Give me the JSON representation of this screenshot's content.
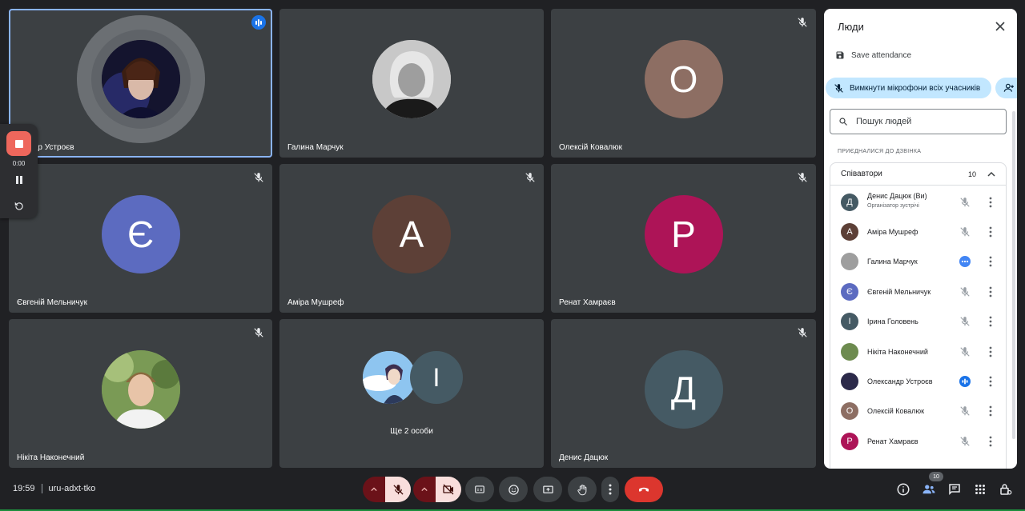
{
  "meeting": {
    "time": "19:59",
    "code": "uru-adxt-tko"
  },
  "recording": {
    "timer": "0:00"
  },
  "tiles": [
    {
      "name": "ксандр Устроєв",
      "speaking": true
    },
    {
      "name": "Галина Марчук"
    },
    {
      "name": "Олексій Ковалюк",
      "initial": "О",
      "color": "#8d6e63"
    },
    {
      "name": "Євгеній Мельничук",
      "initial": "Є",
      "color": "#5c6bc0"
    },
    {
      "name": "Аміра Мушреф",
      "initial": "А",
      "color": "#5d4037"
    },
    {
      "name": "Ренат Хамраєв",
      "initial": "Р",
      "color": "#ad1457"
    },
    {
      "name": "Нікіта Наконечний"
    },
    {
      "more_label": "Ще 2 особи",
      "initial": "І",
      "color": "#455a64"
    },
    {
      "name": "Денис Дацюк",
      "initial": "Д",
      "color": "#455a64"
    }
  ],
  "panel": {
    "title": "Люди",
    "save_attendance": "Save attendance",
    "mute_all": "Вимкнути мікрофони всіх учасників",
    "search_placeholder": "Пошук людей",
    "joined_label": "Приєдналися до дзвінка",
    "group_name": "Співавтори",
    "group_count": "10",
    "people": [
      {
        "name": "Денис Дацюк (Ви)",
        "sub": "Організатор зустрічі",
        "initial": "Д",
        "color": "#455a64",
        "status": "muted"
      },
      {
        "name": "Аміра Мушреф",
        "initial": "А",
        "color": "#5d4037",
        "status": "muted"
      },
      {
        "name": "Галина Марчук",
        "initial": "",
        "color": "#9e9e9e",
        "status": "dots"
      },
      {
        "name": "Євгеній Мельничук",
        "initial": "Є",
        "color": "#5c6bc0",
        "status": "muted"
      },
      {
        "name": "Ірина Головень",
        "initial": "І",
        "color": "#455a64",
        "status": "muted"
      },
      {
        "name": "Нікіта Наконечний",
        "initial": "",
        "color": "#6d8b4f",
        "status": "muted"
      },
      {
        "name": "Олександр Устроєв",
        "initial": "",
        "color": "#2c2a4a",
        "status": "speaking"
      },
      {
        "name": "Олексій Ковалюк",
        "initial": "О",
        "color": "#8d6e63",
        "status": "muted"
      },
      {
        "name": "Ренат Хамраєв",
        "initial": "Р",
        "color": "#ad1457",
        "status": "muted"
      }
    ]
  },
  "toolbar": {
    "people_badge": "10"
  },
  "colors": {
    "background": "#202124",
    "tile": "#3c4043",
    "accent": "#8ab4f8",
    "hangup": "#dc362e",
    "muted_button": "#f9dedc",
    "panel_chip": "#c2e7ff"
  }
}
